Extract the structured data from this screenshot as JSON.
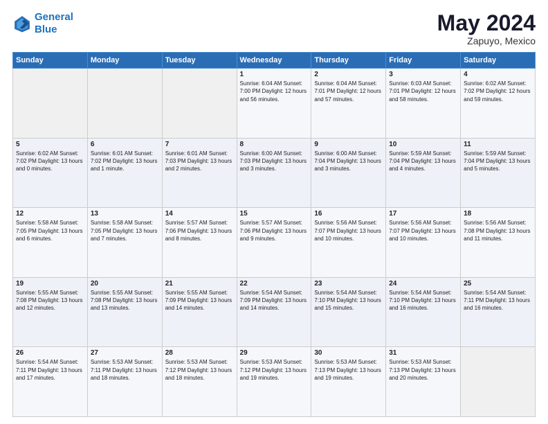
{
  "logo": {
    "line1": "General",
    "line2": "Blue"
  },
  "title": "May 2024",
  "location": "Zapuyo, Mexico",
  "header_days": [
    "Sunday",
    "Monday",
    "Tuesday",
    "Wednesday",
    "Thursday",
    "Friday",
    "Saturday"
  ],
  "weeks": [
    [
      {
        "day": "",
        "info": ""
      },
      {
        "day": "",
        "info": ""
      },
      {
        "day": "",
        "info": ""
      },
      {
        "day": "1",
        "info": "Sunrise: 6:04 AM\nSunset: 7:00 PM\nDaylight: 12 hours\nand 56 minutes."
      },
      {
        "day": "2",
        "info": "Sunrise: 6:04 AM\nSunset: 7:01 PM\nDaylight: 12 hours\nand 57 minutes."
      },
      {
        "day": "3",
        "info": "Sunrise: 6:03 AM\nSunset: 7:01 PM\nDaylight: 12 hours\nand 58 minutes."
      },
      {
        "day": "4",
        "info": "Sunrise: 6:02 AM\nSunset: 7:02 PM\nDaylight: 12 hours\nand 59 minutes."
      }
    ],
    [
      {
        "day": "5",
        "info": "Sunrise: 6:02 AM\nSunset: 7:02 PM\nDaylight: 13 hours\nand 0 minutes."
      },
      {
        "day": "6",
        "info": "Sunrise: 6:01 AM\nSunset: 7:02 PM\nDaylight: 13 hours\nand 1 minute."
      },
      {
        "day": "7",
        "info": "Sunrise: 6:01 AM\nSunset: 7:03 PM\nDaylight: 13 hours\nand 2 minutes."
      },
      {
        "day": "8",
        "info": "Sunrise: 6:00 AM\nSunset: 7:03 PM\nDaylight: 13 hours\nand 3 minutes."
      },
      {
        "day": "9",
        "info": "Sunrise: 6:00 AM\nSunset: 7:04 PM\nDaylight: 13 hours\nand 3 minutes."
      },
      {
        "day": "10",
        "info": "Sunrise: 5:59 AM\nSunset: 7:04 PM\nDaylight: 13 hours\nand 4 minutes."
      },
      {
        "day": "11",
        "info": "Sunrise: 5:59 AM\nSunset: 7:04 PM\nDaylight: 13 hours\nand 5 minutes."
      }
    ],
    [
      {
        "day": "12",
        "info": "Sunrise: 5:58 AM\nSunset: 7:05 PM\nDaylight: 13 hours\nand 6 minutes."
      },
      {
        "day": "13",
        "info": "Sunrise: 5:58 AM\nSunset: 7:05 PM\nDaylight: 13 hours\nand 7 minutes."
      },
      {
        "day": "14",
        "info": "Sunrise: 5:57 AM\nSunset: 7:06 PM\nDaylight: 13 hours\nand 8 minutes."
      },
      {
        "day": "15",
        "info": "Sunrise: 5:57 AM\nSunset: 7:06 PM\nDaylight: 13 hours\nand 9 minutes."
      },
      {
        "day": "16",
        "info": "Sunrise: 5:56 AM\nSunset: 7:07 PM\nDaylight: 13 hours\nand 10 minutes."
      },
      {
        "day": "17",
        "info": "Sunrise: 5:56 AM\nSunset: 7:07 PM\nDaylight: 13 hours\nand 10 minutes."
      },
      {
        "day": "18",
        "info": "Sunrise: 5:56 AM\nSunset: 7:08 PM\nDaylight: 13 hours\nand 11 minutes."
      }
    ],
    [
      {
        "day": "19",
        "info": "Sunrise: 5:55 AM\nSunset: 7:08 PM\nDaylight: 13 hours\nand 12 minutes."
      },
      {
        "day": "20",
        "info": "Sunrise: 5:55 AM\nSunset: 7:08 PM\nDaylight: 13 hours\nand 13 minutes."
      },
      {
        "day": "21",
        "info": "Sunrise: 5:55 AM\nSunset: 7:09 PM\nDaylight: 13 hours\nand 14 minutes."
      },
      {
        "day": "22",
        "info": "Sunrise: 5:54 AM\nSunset: 7:09 PM\nDaylight: 13 hours\nand 14 minutes."
      },
      {
        "day": "23",
        "info": "Sunrise: 5:54 AM\nSunset: 7:10 PM\nDaylight: 13 hours\nand 15 minutes."
      },
      {
        "day": "24",
        "info": "Sunrise: 5:54 AM\nSunset: 7:10 PM\nDaylight: 13 hours\nand 16 minutes."
      },
      {
        "day": "25",
        "info": "Sunrise: 5:54 AM\nSunset: 7:11 PM\nDaylight: 13 hours\nand 16 minutes."
      }
    ],
    [
      {
        "day": "26",
        "info": "Sunrise: 5:54 AM\nSunset: 7:11 PM\nDaylight: 13 hours\nand 17 minutes."
      },
      {
        "day": "27",
        "info": "Sunrise: 5:53 AM\nSunset: 7:11 PM\nDaylight: 13 hours\nand 18 minutes."
      },
      {
        "day": "28",
        "info": "Sunrise: 5:53 AM\nSunset: 7:12 PM\nDaylight: 13 hours\nand 18 minutes."
      },
      {
        "day": "29",
        "info": "Sunrise: 5:53 AM\nSunset: 7:12 PM\nDaylight: 13 hours\nand 19 minutes."
      },
      {
        "day": "30",
        "info": "Sunrise: 5:53 AM\nSunset: 7:13 PM\nDaylight: 13 hours\nand 19 minutes."
      },
      {
        "day": "31",
        "info": "Sunrise: 5:53 AM\nSunset: 7:13 PM\nDaylight: 13 hours\nand 20 minutes."
      },
      {
        "day": "",
        "info": ""
      }
    ]
  ]
}
